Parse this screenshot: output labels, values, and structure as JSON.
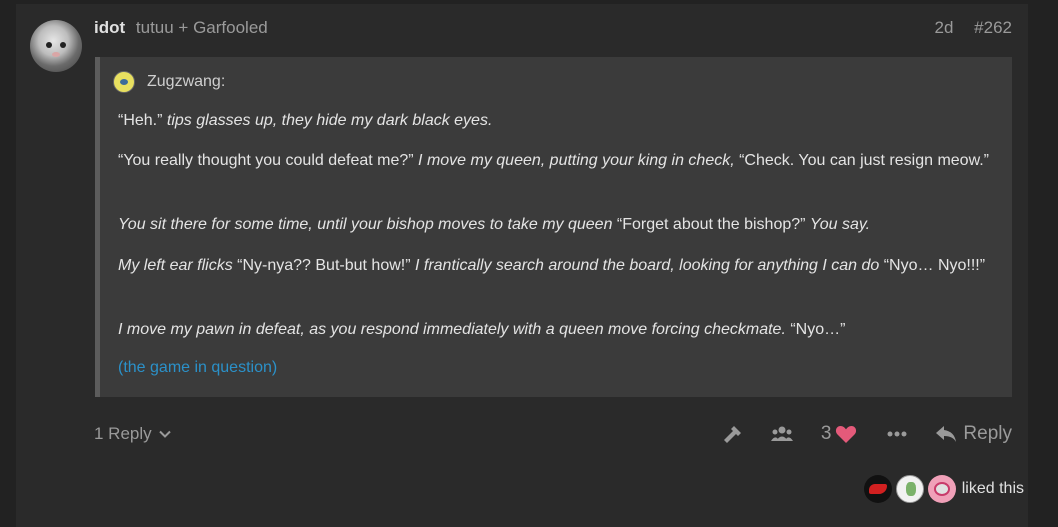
{
  "post": {
    "username": "idot",
    "full_name": "tutuu + Garfooled",
    "age": "2d",
    "number": "#262"
  },
  "quote": {
    "author": "Zugzwang:",
    "p1": [
      {
        "t": "“Heh.” ",
        "i": false
      },
      {
        "t": "tips glasses up, they hide my dark black eyes.",
        "i": true
      }
    ],
    "p2": [
      {
        "t": "“You really thought you could defeat me?” ",
        "i": false
      },
      {
        "t": "I move my queen, putting your king in check,",
        "i": true
      },
      {
        "t": " “Check. You can just resign meow.”",
        "i": false
      }
    ],
    "p3": [
      {
        "t": "You sit there for some time, until your bishop moves to take my queen",
        "i": true
      },
      {
        "t": " “Forget about the bishop?” ",
        "i": false
      },
      {
        "t": "You say.",
        "i": true
      }
    ],
    "p4": [
      {
        "t": "My left ear flicks",
        "i": true
      },
      {
        "t": " “Ny-nya?? But-but how!” ",
        "i": false
      },
      {
        "t": "I frantically search around the board, looking for anything I can do",
        "i": true
      },
      {
        "t": " “Nyo… Nyo!!!”",
        "i": false
      }
    ],
    "p5": [
      {
        "t": "I move my pawn in defeat, as you respond immediately with a queen move forcing checkmate.",
        "i": true
      },
      {
        "t": " “Nyo…”",
        "i": false
      }
    ],
    "link": "(the game in question)"
  },
  "footer": {
    "replies": "1 Reply",
    "like_count": "3",
    "reply_label": "Reply",
    "liked_text": "liked this"
  },
  "icons": {
    "wrench": "wrench-icon",
    "group": "group-icon",
    "heart": "heart-icon",
    "more": "ellipsis-icon",
    "reply": "reply-icon",
    "chevron": "chevron-down-icon"
  },
  "colors": {
    "link": "#2b91c9",
    "heart": "#e45a7a",
    "background": "#222222",
    "panel": "#2a2a2a",
    "quote_bg": "#3b3b3b"
  }
}
